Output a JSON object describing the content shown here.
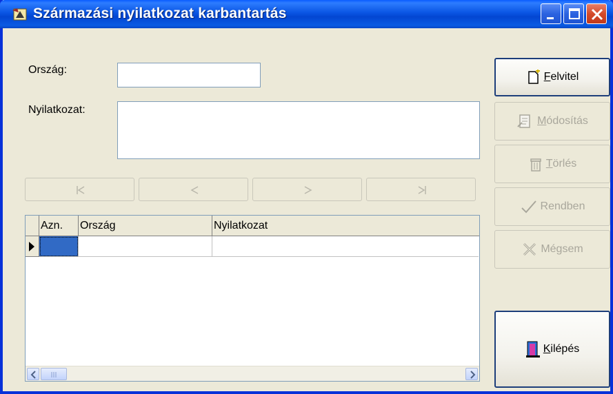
{
  "window": {
    "title": "Származási nyilatkozat karbantartás",
    "controls": [
      "minimize",
      "maximize",
      "close"
    ]
  },
  "form": {
    "country_label": "Ország:",
    "country_value": "",
    "declaration_label": "Nyilatkozat:",
    "declaration_value": ""
  },
  "navigator": {
    "buttons": [
      {
        "icon": "first-record-icon",
        "enabled": false
      },
      {
        "icon": "prior-record-icon",
        "enabled": false
      },
      {
        "icon": "next-record-icon",
        "enabled": false
      },
      {
        "icon": "last-record-icon",
        "enabled": false
      }
    ]
  },
  "grid": {
    "columns": [
      "Azn.",
      "Ország",
      "Nyilatkozat"
    ],
    "rows": [
      {
        "azn": "",
        "orszag": "",
        "nyilatkozat": ""
      }
    ]
  },
  "actions": {
    "felvitel": {
      "label_key": "F",
      "label_rest": "elvitel",
      "icon": "new-document-icon",
      "enabled": true
    },
    "modositas": {
      "label_key": "M",
      "label_rest": "ódosítás",
      "icon": "edit-document-icon",
      "enabled": false
    },
    "torles": {
      "label_key": "T",
      "label_rest": "örlés",
      "icon": "trash-icon",
      "enabled": false
    },
    "rendben": {
      "label": "Rendben",
      "icon": "checkmark-icon",
      "enabled": false
    },
    "megsem": {
      "label": "Mégsem",
      "icon": "x-icon",
      "enabled": false
    },
    "kilepes": {
      "label_key": "K",
      "label_rest": "ilépés",
      "icon": "exit-door-icon",
      "enabled": true
    }
  },
  "colors": {
    "titlebar": "#0a55e3",
    "window_bg": "#ece9d8",
    "disabled_text": "#a9a79c",
    "selection": "#316ac5"
  }
}
